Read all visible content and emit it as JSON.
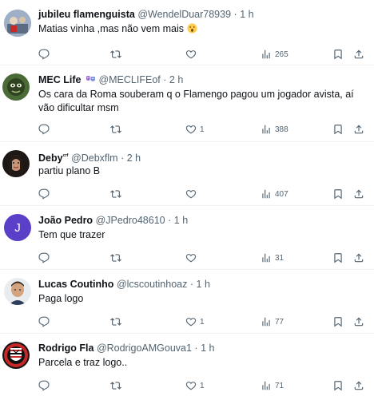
{
  "tweets": [
    {
      "name": "jubileu flamenguista",
      "handle": "@WendelDuar78939",
      "dot": "·",
      "time": "1 h",
      "text": "Matias vinha ,mas não vem mais",
      "reply_count": "",
      "retweet_count": "",
      "like_count": "",
      "views": "265",
      "avatar_color": "#7a8aa0"
    },
    {
      "name": "MEC Life",
      "handle": "@MECLIFEof",
      "dot": "·",
      "time": "2 h",
      "text": "Os cara da Roma souberam q o Flamengo pagou um jogador avista, aí vão dificultar msm",
      "reply_count": "",
      "retweet_count": "",
      "like_count": "1",
      "views": "388",
      "avatar_color": "#3d5a2a"
    },
    {
      "name": "Deby",
      "name_suffix": "ᶜʳᶠ",
      "handle": "@Debxflm",
      "dot": "·",
      "time": "2 h",
      "text": "partiu plano B",
      "reply_count": "",
      "retweet_count": "",
      "like_count": "",
      "views": "407",
      "avatar_color": "#2b2320"
    },
    {
      "name": "João Pedro",
      "handle": "@JPedro48610",
      "dot": "·",
      "time": "1 h",
      "text": "Tem que trazer",
      "reply_count": "",
      "retweet_count": "",
      "like_count": "",
      "views": "31",
      "avatar_letter": "J",
      "avatar_color": "#5a3fc9"
    },
    {
      "name": "Lucas Coutinho",
      "handle": "@lcscoutinhoaz",
      "dot": "·",
      "time": "1 h",
      "text": "Paga logo",
      "reply_count": "",
      "retweet_count": "",
      "like_count": "1",
      "views": "77",
      "avatar_color": "#c9a27a"
    },
    {
      "name": "Rodrigo Fla",
      "handle": "@RodrigoAMGouva1",
      "dot": "·",
      "time": "1 h",
      "text": "Parcela e traz logo..",
      "reply_count": "",
      "retweet_count": "",
      "like_count": "1",
      "views": "71",
      "avatar_color": "#b71c1c"
    }
  ],
  "colors": {
    "text": "#0f1419",
    "secondary": "#536471",
    "divider": "#eff3f4"
  },
  "icons": {
    "reply": "reply-icon",
    "retweet": "retweet-icon",
    "like": "heart-icon",
    "views": "views-icon",
    "bookmark": "bookmark-icon",
    "share": "share-icon"
  }
}
